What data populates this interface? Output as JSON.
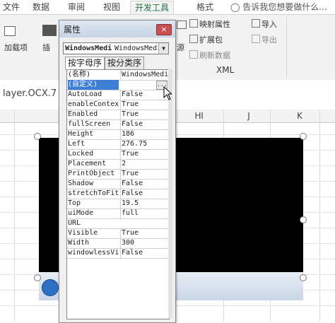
{
  "ribbon_tabs": {
    "file": "文件",
    "data": "数据",
    "review": "审阅",
    "view": "视图",
    "developer": "开发工具",
    "format": "格式",
    "tell_me": "告诉我您想要做什么..."
  },
  "ribbon": {
    "add_ins": "加载项",
    "insert": "插",
    "source_fragment": "源",
    "map_properties": "映射属性",
    "expansion_packs": "扩展包",
    "refresh_data": "刷新数据",
    "import": "导入",
    "export": "导出",
    "xml_group": "XML"
  },
  "formula_bar": {
    "cell_text": "layer.OCX.7"
  },
  "columns": [
    "H",
    "I",
    "J",
    "K"
  ],
  "properties": {
    "title": "属性",
    "close": "×",
    "object_name": "WindowsMedi",
    "object_type": "WindowsMedi",
    "tab_alphabetic": "按字母序",
    "tab_categorized": "按分类序",
    "ellipsis": "...",
    "rows": [
      {
        "key": "(名称)",
        "value": "WindowsMedi"
      },
      {
        "key": "(自定义)",
        "value": ""
      },
      {
        "key": "AutoLoad",
        "value": "False"
      },
      {
        "key": "enableContext",
        "value": "True"
      },
      {
        "key": "Enabled",
        "value": "True"
      },
      {
        "key": "fullScreen",
        "value": "False"
      },
      {
        "key": "Height",
        "value": "186"
      },
      {
        "key": "Left",
        "value": "276.75"
      },
      {
        "key": "Locked",
        "value": "True"
      },
      {
        "key": "Placement",
        "value": "2"
      },
      {
        "key": "PrintObject",
        "value": "True"
      },
      {
        "key": "Shadow",
        "value": "False"
      },
      {
        "key": "stretchToFit",
        "value": "False"
      },
      {
        "key": "Top",
        "value": "19.5"
      },
      {
        "key": "uiMode",
        "value": "full"
      },
      {
        "key": "URL",
        "value": ""
      },
      {
        "key": "Visible",
        "value": "True"
      },
      {
        "key": "Width",
        "value": "300"
      },
      {
        "key": "windowlessVid",
        "value": "False"
      }
    ]
  },
  "colors": {
    "accent": "#217346",
    "selected_row": "#3e7fd6",
    "close_button": "#c75050"
  }
}
